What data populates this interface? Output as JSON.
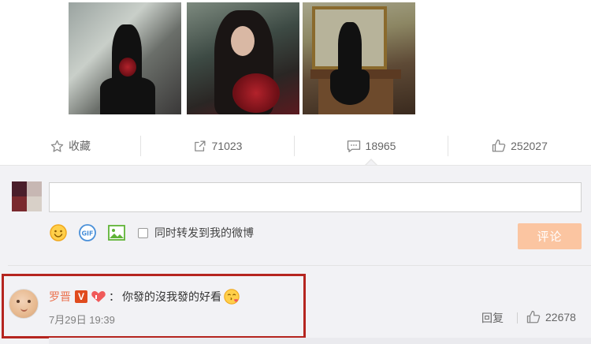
{
  "photos": [
    {
      "alt_icon": "photo-woman-seated-roses"
    },
    {
      "alt_icon": "photo-woman-portrait-roses"
    },
    {
      "alt_icon": "photo-woman-fireplace"
    }
  ],
  "actions": {
    "favorite": {
      "icon": "star-icon",
      "label": "收藏"
    },
    "repost": {
      "icon": "share-icon",
      "count": "71023"
    },
    "comment": {
      "icon": "comment-icon",
      "count": "18965"
    },
    "like": {
      "icon": "thumbs-up-icon",
      "count": "252027"
    }
  },
  "composer": {
    "input_value": "",
    "tools": [
      "emoji-icon",
      "gif-icon",
      "image-icon"
    ],
    "repost_checkbox_label": "同时转发到我的微博",
    "submit_label": "评论"
  },
  "comment": {
    "username": "罗晋",
    "verified_badge": "V",
    "separator": "：",
    "text": "你發的沒我發的好看",
    "timestamp": "7月29日 19:39",
    "reply_label": "回复",
    "like_count": "22678"
  },
  "colors": {
    "accent_orange": "#eb7350",
    "submit_disabled": "#fbc5a1",
    "highlight_border": "#b5251f",
    "verified_badge": "#e04b1e"
  }
}
